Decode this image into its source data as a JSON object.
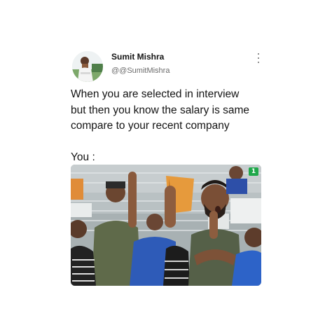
{
  "tweet": {
    "display_name": "Sumit Mishra",
    "handle": "@@SumitMishra",
    "text_lines": [
      "When you are selected in interview",
      "but then you know the salary is same",
      "compare to your recent company"
    ],
    "text_you": "You :",
    "more_icon": "more-vertical-icon"
  },
  "media": {
    "description_icon": "photo",
    "badge_text": "1"
  },
  "colors": {
    "text": "#141414",
    "muted": "#6b6b6b",
    "background": "#ffffff",
    "badge": "#1fa84a"
  }
}
